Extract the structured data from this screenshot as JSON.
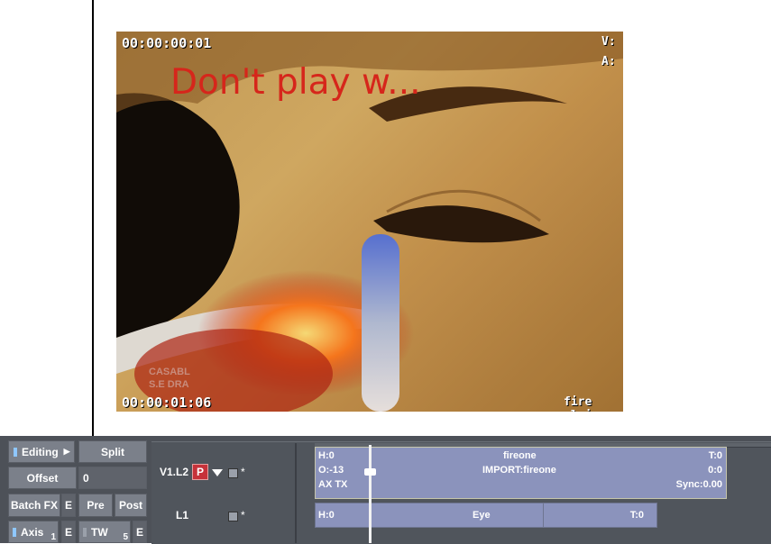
{
  "viewer": {
    "timecode_top": "00:00:00:01",
    "timecode_bottom": "00:00:01:06",
    "track_v": "V:",
    "track_a": "A:",
    "title_overlay": "Don't play w...",
    "watermark_1": "CASABL",
    "watermark_2": "S.E DRA",
    "corner_text": "fire plai"
  },
  "controls": {
    "editing": "Editing",
    "split": "Split",
    "offset": "Offset",
    "offset_value": "0",
    "batch_fx": "Batch FX",
    "e": "E",
    "pre": "Pre",
    "post": "Post",
    "axis": "Axis",
    "axis_num": "1",
    "tw": "TW",
    "tw_num": "5"
  },
  "tracks": {
    "v1_label": "V1.L2",
    "p_badge": "P",
    "star": "*",
    "l1_label": "L1"
  },
  "clips": {
    "fireone": {
      "h": "H:0",
      "o": "O:-13",
      "ax": "AX TX",
      "name": "fireone",
      "source": "IMPORT:fireone",
      "t": "T:0",
      "zero": "0:0",
      "sync": "Sync:0.00"
    },
    "eye": {
      "h": "H:0",
      "name": "Eye",
      "t": "T:0"
    }
  }
}
